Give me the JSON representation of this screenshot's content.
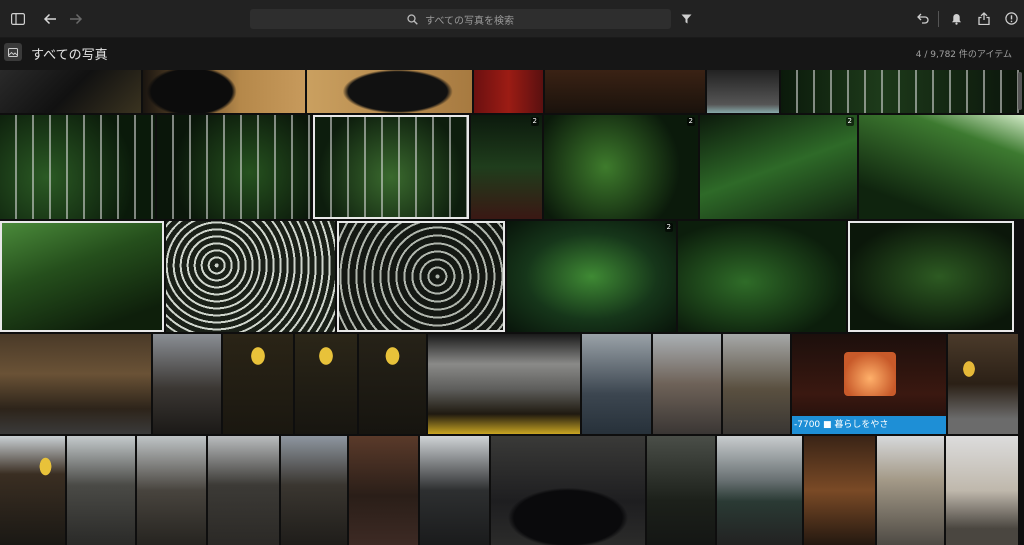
{
  "toolbar": {
    "search_placeholder": "すべての写真を検索",
    "icons": [
      "sidebar-toggle-icon",
      "back-arrow-icon",
      "forward-arrow-icon",
      "search-icon",
      "filter-icon",
      "undo-icon",
      "notification-bell-icon",
      "share-icon",
      "help-icon"
    ]
  },
  "header": {
    "title": "すべての写真",
    "count": "4 / 9,782 件のアイテム"
  },
  "grid": {
    "badge": "2",
    "sign_text": "-7700 ■ 暮らしをやさ"
  },
  "colors": {
    "toolbar_bg": "#222222",
    "subbar_bg": "#161616",
    "selection_border": "#e8e8e8",
    "sign_blue": "#1e8fd6"
  }
}
